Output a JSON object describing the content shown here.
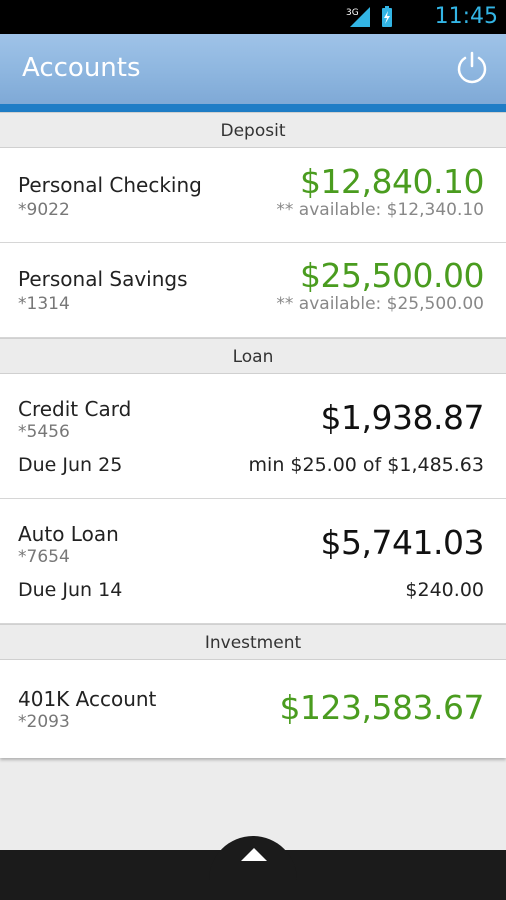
{
  "status_bar": {
    "network": "3G",
    "time": "11:45"
  },
  "app_bar": {
    "title": "Accounts",
    "power_icon": "power-icon"
  },
  "colors": {
    "app_bar": "#8fb7e0",
    "accent_rule": "#1f7dc6",
    "positive_amount": "#4a9c1f",
    "time": "#33b5e5"
  },
  "sections": {
    "deposit": {
      "header": "Deposit",
      "accounts": [
        {
          "name": "Personal Checking",
          "number": "*9022",
          "balance": "$12,840.10",
          "available": "** available: $12,340.10"
        },
        {
          "name": "Personal Savings",
          "number": "*1314",
          "balance": "$25,500.00",
          "available": "** available: $25,500.00"
        }
      ]
    },
    "loan": {
      "header": "Loan",
      "accounts": [
        {
          "name": "Credit Card",
          "number": "*5456",
          "balance": "$1,938.87",
          "due": "Due Jun 25",
          "payment": "min $25.00 of $1,485.63"
        },
        {
          "name": "Auto Loan",
          "number": "*7654",
          "balance": "$5,741.03",
          "due": "Due Jun 14",
          "payment": "$240.00"
        }
      ]
    },
    "investment": {
      "header": "Investment",
      "accounts": [
        {
          "name": "401K Account",
          "number": "*2093",
          "balance": "$123,583.67"
        }
      ]
    }
  },
  "bottom": {
    "drawer_icon": "chevron-up-icon"
  }
}
